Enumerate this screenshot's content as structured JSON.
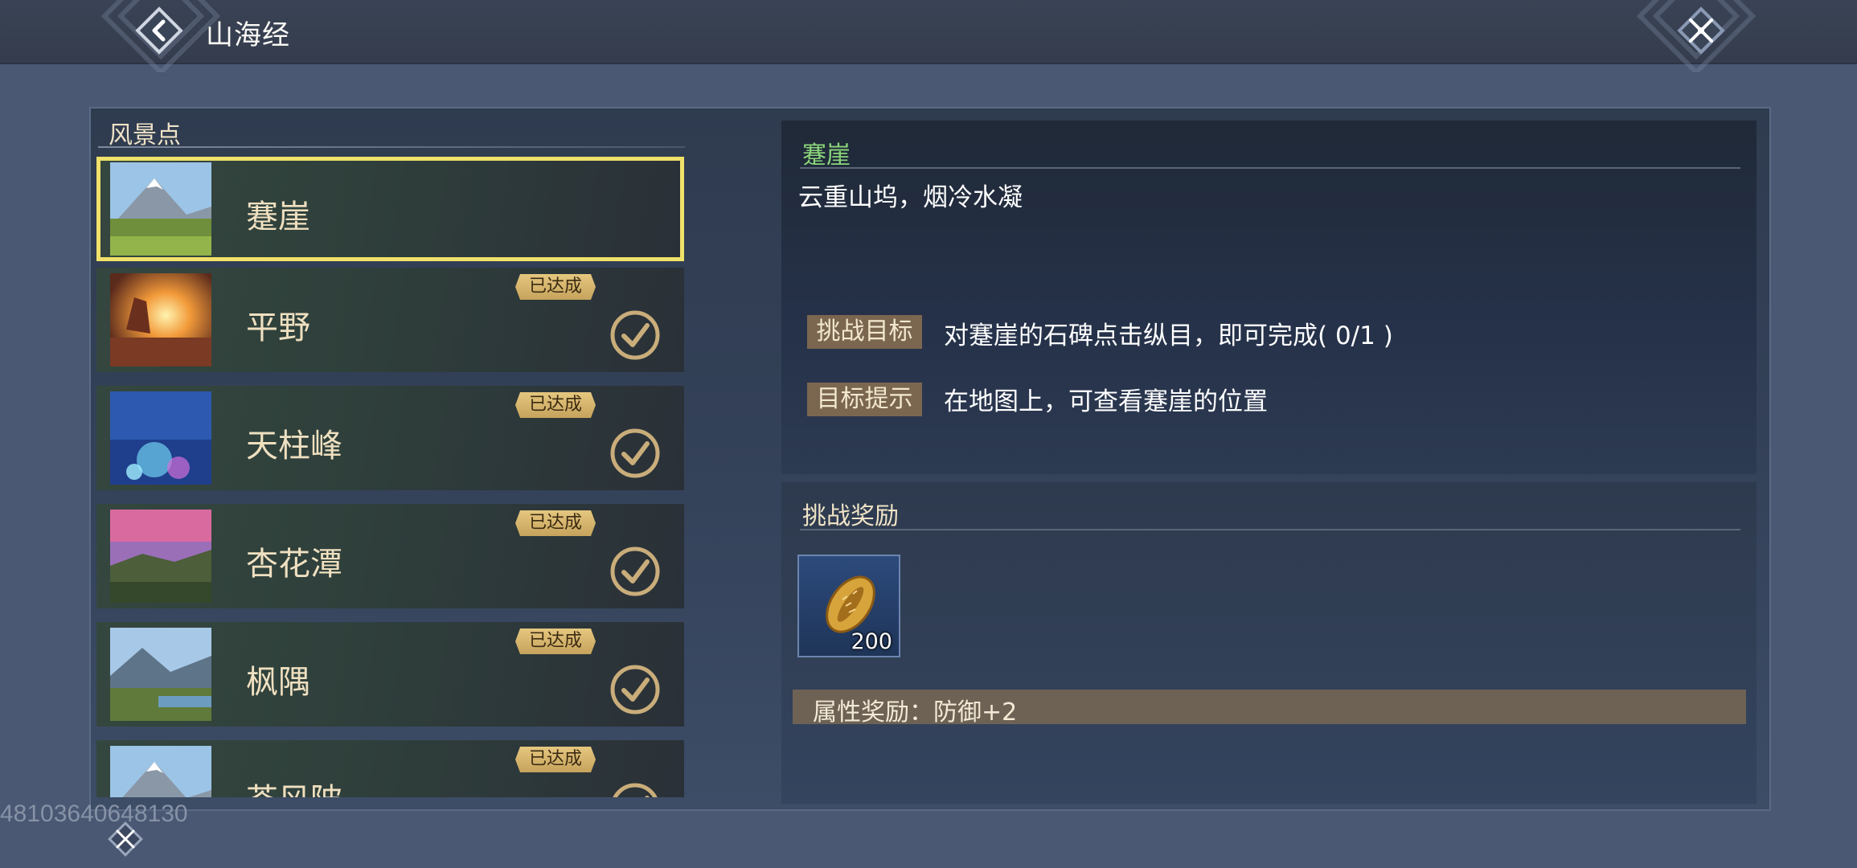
{
  "app": {
    "title": "山海经"
  },
  "icons": {
    "back": "back-arrow-icon",
    "close": "crossed-swords-close-icon",
    "check": "check-circle-icon",
    "bottom": "crossed-swords-icon"
  },
  "list": {
    "header": "风景点",
    "items": [
      {
        "name": "蹇崖",
        "selected": true,
        "badge": "",
        "completed": false,
        "thumb": "snow-mountain-meadow"
      },
      {
        "name": "平野",
        "selected": false,
        "badge": "已达成",
        "completed": true,
        "thumb": "sunset-rocks"
      },
      {
        "name": "天柱峰",
        "selected": false,
        "badge": "已达成",
        "completed": true,
        "thumb": "underwater-coral"
      },
      {
        "name": "杏花潭",
        "selected": false,
        "badge": "已达成",
        "completed": true,
        "thumb": "pink-sky-lake"
      },
      {
        "name": "枫隅",
        "selected": false,
        "badge": "已达成",
        "completed": true,
        "thumb": "mountain-valley"
      },
      {
        "name": "苍风陂",
        "selected": false,
        "badge": "已达成",
        "completed": true,
        "thumb": "snow-mountain-meadow"
      }
    ]
  },
  "detail": {
    "title": "蹇崖",
    "description": "云重山坞，烟冷水凝",
    "goal_label": "挑战目标",
    "goal_text": "对蹇崖的石碑点击纵目，即可完成( 0/1 )",
    "hint_label": "目标提示",
    "hint_text": "在地图上，可查看蹇崖的位置"
  },
  "reward": {
    "title": "挑战奖励",
    "item_icon": "golden-shell-coin-icon",
    "item_count": "200",
    "attribute": "属性奖励：防御+2"
  },
  "overlay": {
    "uid": "48103640648130"
  },
  "colors": {
    "accent_green": "#8cd67a",
    "selected_outline": "#f0e16a",
    "badge_gold": "#d9b86e",
    "tag_brown": "#7b6650"
  }
}
